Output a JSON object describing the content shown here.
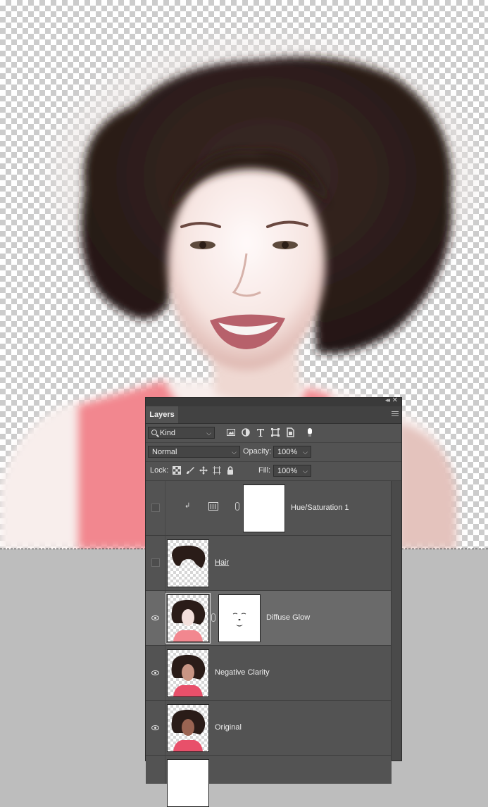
{
  "canvas": {
    "icon": "portrait-photo",
    "colors": {
      "hair": "#2e201c",
      "skin": "#f7e9e6",
      "top": "#f2878f"
    }
  },
  "layers_panel": {
    "tab_label": "Layers",
    "collapse_icon": "double-chevron-icon",
    "close_icon": "close-icon",
    "menu_icon": "panel-menu-icon",
    "filter": {
      "kind_label": "Kind"
    },
    "blend_mode": "Normal",
    "opacity_label": "Opacity:",
    "opacity_value": "100%",
    "lock_label": "Lock:",
    "fill_label": "Fill:",
    "fill_value": "100%",
    "layers": [
      {
        "name": "Hue/Saturation 1",
        "visible": false,
        "kind": "adjustment",
        "clipped": true
      },
      {
        "name": "Hair",
        "visible": false,
        "kind": "pixel"
      },
      {
        "name": "Diffuse Glow",
        "visible": true,
        "kind": "pixel-with-mask",
        "selected": true
      },
      {
        "name": "Negative Clarity",
        "visible": true,
        "kind": "pixel"
      },
      {
        "name": "Original",
        "visible": true,
        "kind": "pixel"
      }
    ]
  }
}
